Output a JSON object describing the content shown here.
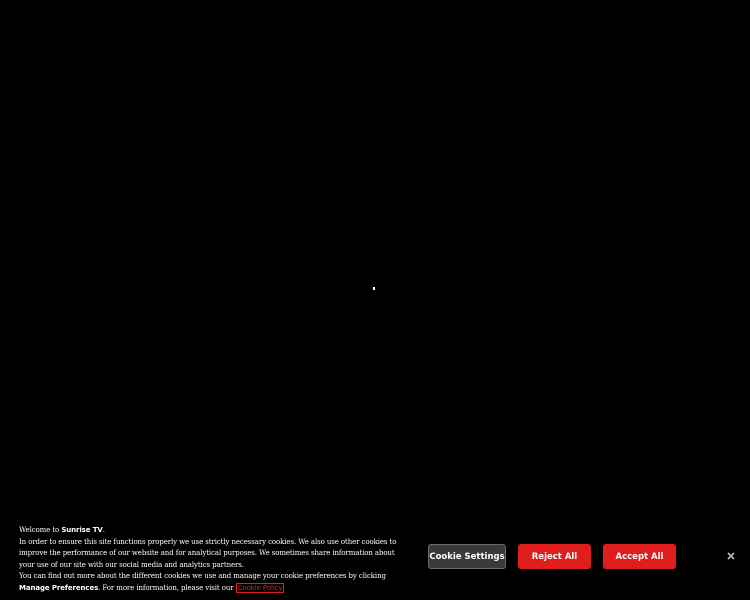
{
  "cookie_banner": {
    "welcome_prefix": "Welcome to ",
    "brand_name": "Sunrise TV",
    "welcome_suffix": ".",
    "body_text": "In order to ensure this site functions properly we use strictly necessary cookies. We also use other cookies to improve the performance of our website and for analytical purposes. We sometimes share information about your use of our site with our social media and analytics partners.",
    "manage_prefix": "You can find out more about the different cookies we use and manage your cookie preferences by clicking ",
    "manage_link": "Manage Preferences",
    "manage_suffix": ". For more information, please visit our ",
    "policy_link": "Cookie Policy",
    "buttons": {
      "settings": "Cookie Settings",
      "reject": "Reject All",
      "accept": "Accept All"
    },
    "close_icon": "close-icon"
  },
  "colors": {
    "background": "#000000",
    "accent": "#e01e1e",
    "settings_button": "#3a3a3a"
  }
}
